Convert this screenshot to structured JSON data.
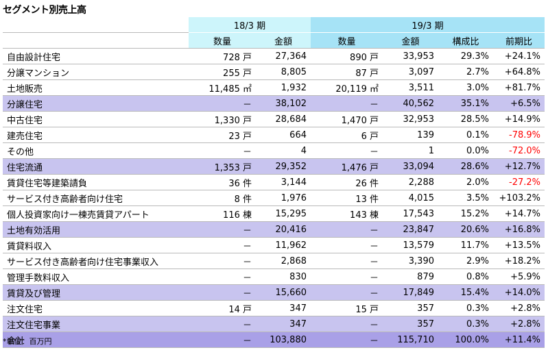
{
  "title": "セグメント別売上高",
  "periods": [
    "18/3 期",
    "19/3 期"
  ],
  "headers": [
    "数量",
    "金額",
    "数量",
    "金額",
    "構成比",
    "前期比"
  ],
  "rows": [
    {
      "label": "自由設計住宅",
      "q18": "728 戸",
      "a18": "27,364",
      "q19": "890 戸",
      "a19": "33,953",
      "comp": "29.3%",
      "yoy": "+24.1%",
      "type": "normal",
      "neg": false
    },
    {
      "label": "分譲マンション",
      "q18": "255 戸",
      "a18": "8,805",
      "q19": "87 戸",
      "a19": "3,097",
      "comp": "2.7%",
      "yoy": "+64.8%",
      "type": "normal",
      "neg": false
    },
    {
      "label": "土地販売",
      "q18": "11,485 ㎡",
      "a18": "1,932",
      "q19": "20,119 ㎡",
      "a19": "3,511",
      "comp": "3.0%",
      "yoy": "+81.7%",
      "type": "normal",
      "neg": false
    },
    {
      "label": "分譲住宅",
      "q18": "－",
      "a18": "38,102",
      "q19": "－",
      "a19": "40,562",
      "comp": "35.1%",
      "yoy": "+6.5%",
      "type": "subtotal",
      "neg": false
    },
    {
      "label": "中古住宅",
      "q18": "1,330 戸",
      "a18": "28,684",
      "q19": "1,470 戸",
      "a19": "32,953",
      "comp": "28.5%",
      "yoy": "+14.9%",
      "type": "normal",
      "neg": false
    },
    {
      "label": "建売住宅",
      "q18": "23 戸",
      "a18": "664",
      "q19": "6 戸",
      "a19": "139",
      "comp": "0.1%",
      "yoy": "-78.9%",
      "type": "normal",
      "neg": true
    },
    {
      "label": "その他",
      "q18": "－",
      "a18": "4",
      "q19": "－",
      "a19": "1",
      "comp": "0.0%",
      "yoy": "-72.0%",
      "type": "normal",
      "neg": true
    },
    {
      "label": "住宅流通",
      "q18": "1,353 戸",
      "a18": "29,352",
      "q19": "1,476 戸",
      "a19": "33,094",
      "comp": "28.6%",
      "yoy": "+12.7%",
      "type": "subtotal",
      "neg": false
    },
    {
      "label": "賃貸住宅等建築請負",
      "q18": "36 件",
      "a18": "3,144",
      "q19": "26 件",
      "a19": "2,288",
      "comp": "2.0%",
      "yoy": "-27.2%",
      "type": "normal",
      "neg": true
    },
    {
      "label": "サービス付き高齢者向け住宅",
      "q18": "8 件",
      "a18": "1,976",
      "q19": "13 件",
      "a19": "4,015",
      "comp": "3.5%",
      "yoy": "+103.2%",
      "type": "normal",
      "neg": false
    },
    {
      "label": "個人投資家向け一棟売賃貸アパート",
      "q18": "116 棟",
      "a18": "15,295",
      "q19": "143 棟",
      "a19": "17,543",
      "comp": "15.2%",
      "yoy": "+14.7%",
      "type": "normal",
      "neg": false
    },
    {
      "label": "土地有効活用",
      "q18": "－",
      "a18": "20,416",
      "q19": "－",
      "a19": "23,847",
      "comp": "20.6%",
      "yoy": "+16.8%",
      "type": "subtotal",
      "neg": false
    },
    {
      "label": "賃貸料収入",
      "q18": "－",
      "a18": "11,962",
      "q19": "－",
      "a19": "13,579",
      "comp": "11.7%",
      "yoy": "+13.5%",
      "type": "normal",
      "neg": false
    },
    {
      "label": "サービス付き高齢者向け住宅事業収入",
      "q18": "－",
      "a18": "2,868",
      "q19": "－",
      "a19": "3,390",
      "comp": "2.9%",
      "yoy": "+18.2%",
      "type": "normal",
      "neg": false
    },
    {
      "label": "管理手数料収入",
      "q18": "－",
      "a18": "830",
      "q19": "－",
      "a19": "879",
      "comp": "0.8%",
      "yoy": "+5.9%",
      "type": "normal",
      "neg": false
    },
    {
      "label": "賃貸及び管理",
      "q18": "－",
      "a18": "15,660",
      "q19": "－",
      "a19": "17,849",
      "comp": "15.4%",
      "yoy": "+14.0%",
      "type": "subtotal",
      "neg": false
    },
    {
      "label": "注文住宅",
      "q18": "14 戸",
      "a18": "347",
      "q19": "15 戸",
      "a19": "357",
      "comp": "0.3%",
      "yoy": "+2.8%",
      "type": "normal",
      "neg": false
    },
    {
      "label": "注文住宅事業",
      "q18": "－",
      "a18": "347",
      "q19": "－",
      "a19": "357",
      "comp": "0.3%",
      "yoy": "+2.8%",
      "type": "subtotal",
      "neg": false
    },
    {
      "label": "合計",
      "q18": "－",
      "a18": "103,880",
      "q19": "－",
      "a19": "115,710",
      "comp": "100.0%",
      "yoy": "+11.4%",
      "type": "total",
      "neg": false
    }
  ],
  "note": "*単位：百万円",
  "colors": {
    "period18_bg": "#cdf5fb",
    "period19_bg": "#a6e3f6",
    "subtotal_bg": "#c8c4ef",
    "total_bg": "#a9a0e7",
    "negative_text": "#ff0000"
  }
}
